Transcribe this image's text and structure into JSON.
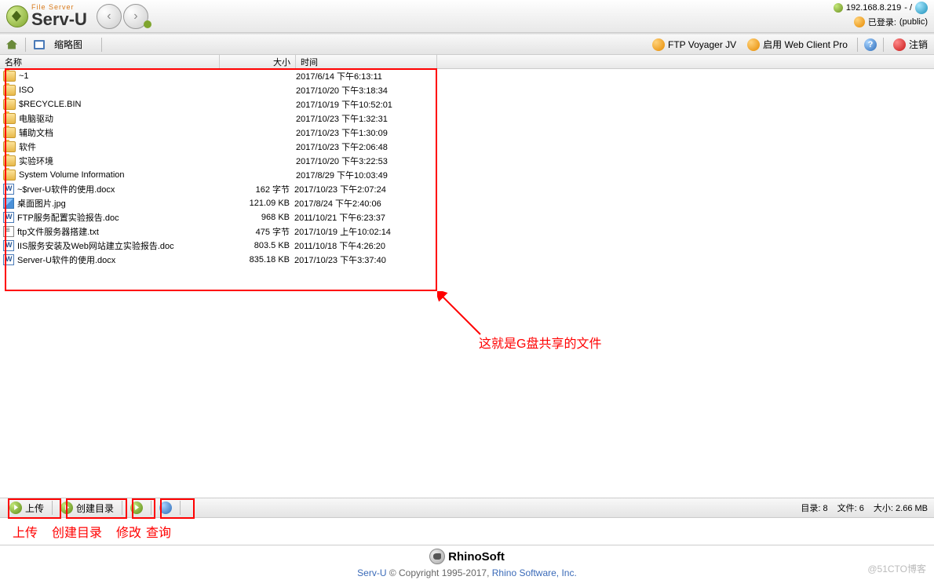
{
  "header": {
    "logo_small": "File Server",
    "logo_big": "Serv-U",
    "ip": "192.168.8.219",
    "ip_suffix": "-  /",
    "login_label": "已登录:",
    "login_user": "(public)"
  },
  "toolbar": {
    "thumbnail_label": "缩略图",
    "ftp_voyager": "FTP Voyager JV",
    "web_client": "启用 Web Client Pro",
    "logout": "注销"
  },
  "columns": {
    "name": "名称",
    "size": "大小",
    "time": "时间"
  },
  "files": [
    {
      "icon": "folder",
      "name": "~1",
      "size": "",
      "time": "2017/6/14 下午6:13:11"
    },
    {
      "icon": "folder",
      "name": "ISO",
      "size": "",
      "time": "2017/10/20 下午3:18:34"
    },
    {
      "icon": "folder",
      "name": "$RECYCLE.BIN",
      "size": "",
      "time": "2017/10/19 下午10:52:01"
    },
    {
      "icon": "folder",
      "name": "电脑驱动",
      "size": "",
      "time": "2017/10/23 下午1:32:31"
    },
    {
      "icon": "folder",
      "name": "辅助文档",
      "size": "",
      "time": "2017/10/23 下午1:30:09"
    },
    {
      "icon": "folder",
      "name": "软件",
      "size": "",
      "time": "2017/10/23 下午2:06:48"
    },
    {
      "icon": "folder",
      "name": "实验环境",
      "size": "",
      "time": "2017/10/20 下午3:22:53"
    },
    {
      "icon": "folder",
      "name": "System Volume Information",
      "size": "",
      "time": "2017/8/29 下午10:03:49"
    },
    {
      "icon": "doc",
      "name": "~$rver-U软件的使用.docx",
      "size": "162 字节",
      "time": "2017/10/23 下午2:07:24"
    },
    {
      "icon": "jpg",
      "name": "桌面图片.jpg",
      "size": "121.09 KB",
      "time": "2017/8/24 下午2:40:06"
    },
    {
      "icon": "doc",
      "name": "FTP服务配置实验报告.doc",
      "size": "968 KB",
      "time": "2011/10/21 下午6:23:37"
    },
    {
      "icon": "txt",
      "name": "ftp文件服务器搭建.txt",
      "size": "475 字节",
      "time": "2017/10/19 上午10:02:14"
    },
    {
      "icon": "doc",
      "name": "IIS服务安装及Web网站建立实验报告.doc",
      "size": "803.5 KB",
      "time": "2011/10/18 下午4:26:20"
    },
    {
      "icon": "doc",
      "name": "Server-U软件的使用.docx",
      "size": "835.18 KB",
      "time": "2017/10/23 下午3:37:40"
    }
  ],
  "annotation": "这就是G盘共享的文件",
  "bottom": {
    "upload": "上传",
    "create_dir": "创建目录"
  },
  "status": {
    "dirs_label": "目录:",
    "dirs": "8",
    "files_label": "文件:",
    "files_count": "6",
    "size_label": "大小:",
    "size": "2.66 MB"
  },
  "bottom_labels": {
    "upload": "上传",
    "create": "创建目录",
    "modify": "修改",
    "query": "查询"
  },
  "footer": {
    "brand": "RhinoSoft",
    "servu": "Serv-U",
    "copyright": " © Copyright 1995-2017, ",
    "rhino_link": "Rhino Software, Inc.",
    "watermark": "@51CTO博客"
  }
}
